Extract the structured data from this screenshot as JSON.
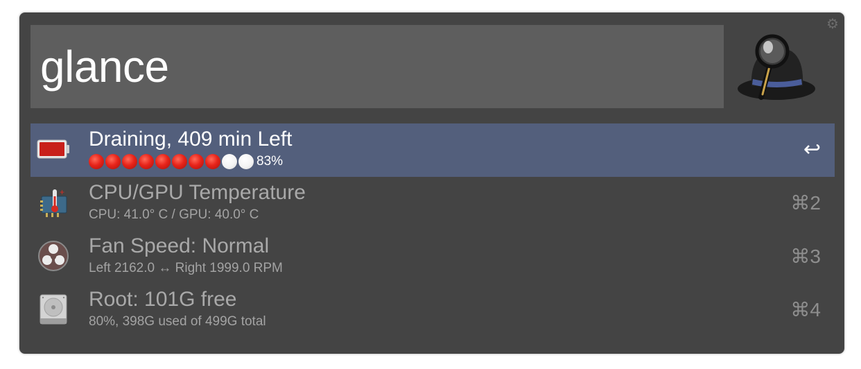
{
  "query": "glance",
  "results": [
    {
      "title": "Draining, 409 min Left",
      "subtitle_value": "83%",
      "battery_dots": {
        "filled": 8,
        "total": 10
      },
      "shortcut": "↩",
      "icon": "battery-icon",
      "selected": true
    },
    {
      "title": "CPU/GPU Temperature",
      "subtitle": "CPU: 41.0° C / GPU: 40.0° C",
      "shortcut": "⌘2",
      "icon": "thermometer-icon",
      "selected": false
    },
    {
      "title": "Fan Speed: Normal",
      "subtitle": "Left 2162.0 ↔ Right 1999.0 RPM",
      "shortcut": "⌘3",
      "icon": "fan-icon",
      "selected": false
    },
    {
      "title": "Root: 101G free",
      "subtitle": "80%, 398G used of 499G total",
      "shortcut": "⌘4",
      "icon": "hard-drive-icon",
      "selected": false
    }
  ],
  "colors": {
    "window_bg": "#444444",
    "search_bg": "#5e5e5e",
    "selected_bg": "#535f7c",
    "battery_red": "#c8201b"
  }
}
